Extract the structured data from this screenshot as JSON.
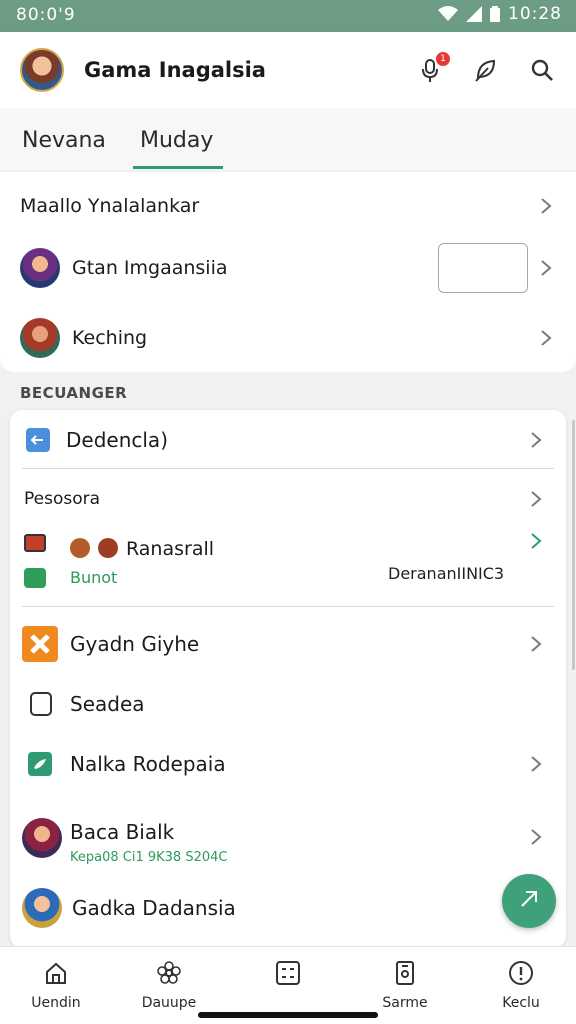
{
  "status_bar": {
    "left_time": "80:0'9",
    "right_time": "10:28"
  },
  "app_bar": {
    "title": "Gama Inagalsia",
    "notification_count": "1",
    "icons": [
      "microphone-icon",
      "feather-icon",
      "search-icon"
    ]
  },
  "tabs": [
    {
      "label": "Nevana"
    },
    {
      "label": "Muday",
      "active": true
    }
  ],
  "top_list": {
    "header_row": {
      "label": "Maallo Ynalalankar"
    },
    "rows": [
      {
        "label": "Gtan Imgaansiia",
        "avatar": "avatar-1"
      },
      {
        "label": "Keching",
        "avatar": "avatar-2"
      }
    ]
  },
  "section_title": "BECUANGER",
  "main_card": {
    "row1": {
      "label": "Dedencla)",
      "icon": "back-arrow-icon"
    },
    "sub_header": "Pesosora",
    "group_row": {
      "label": "Ranasrall",
      "sub_label": "Bunot",
      "right_text": "DerananIINIC3"
    },
    "rows": [
      {
        "label": "Gyadn Giyhe",
        "icon": "orange-x-icon"
      },
      {
        "label": "Seadea",
        "icon": "square-outline-icon"
      },
      {
        "label": "Nalka Rodepaia",
        "icon": "green-leaf-icon"
      }
    ],
    "person_row": {
      "label": "Baca Bialk",
      "sub_label": "Kepa08 Ci1 9K38 S204C"
    },
    "last_row": {
      "label": "Gadka Dadansia"
    }
  },
  "bottom_nav": [
    {
      "label": "Uendin",
      "icon": "home-icon"
    },
    {
      "label": "Dauupe",
      "icon": "flower-icon"
    },
    {
      "label": "",
      "icon": "grid-list-icon"
    },
    {
      "label": "Sarme",
      "icon": "phone-doc-icon"
    },
    {
      "label": "Keclu",
      "icon": "alert-circle-icon"
    }
  ],
  "colors": {
    "accent": "#2e9b72",
    "status_bar": "#6c9c84",
    "fab": "#3ea17a",
    "badge": "#e53935"
  }
}
